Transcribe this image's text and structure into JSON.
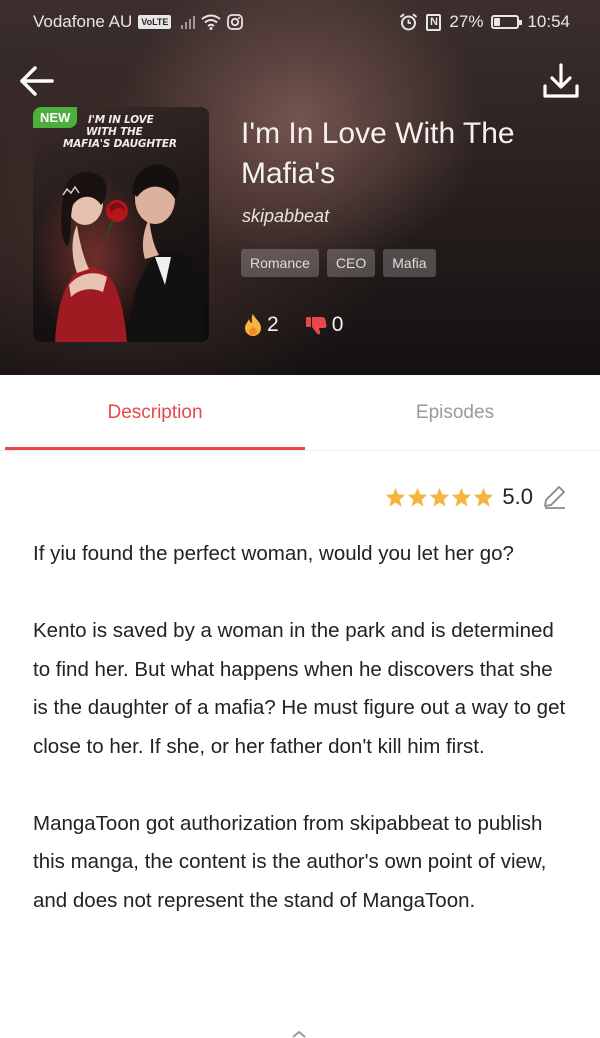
{
  "status_bar": {
    "carrier": "Vodafone AU",
    "volte": "VoLTE",
    "battery": "27%",
    "battery_level": 0.27,
    "time": "10:54"
  },
  "header": {
    "back_icon": "arrow-left-icon",
    "download_icon": "download-icon"
  },
  "book": {
    "badge": "NEW",
    "cover_title": [
      "I'M IN LOVE",
      "WITH THE",
      "MAFIA'S DAUGHTER"
    ],
    "title": "I'm In Love With The Mafia's",
    "author": "skipabbeat",
    "tags": [
      "Romance",
      "CEO",
      "Mafia"
    ],
    "likes": "2",
    "dislikes": "0"
  },
  "tabs": [
    {
      "label": "Description",
      "active": true
    },
    {
      "label": "Episodes",
      "active": false
    }
  ],
  "rating": {
    "stars": 5,
    "value": "5.0"
  },
  "description": [
    "If yiu found the perfect woman, would you let her go?",
    "Kento is saved by a woman in the park and is determined to find her. But what happens when he discovers that she is the daughter of a mafia? He must figure out a way to get close to her. If she, or her father don't kill him first.",
    "MangaToon got authorization from skipabbeat to publish this manga, the content is the author's own point of view, and does not represent the stand of MangaToon."
  ],
  "colors": {
    "accent": "#e8474b",
    "star": "#f5b53f",
    "badge": "#4cae3c"
  }
}
